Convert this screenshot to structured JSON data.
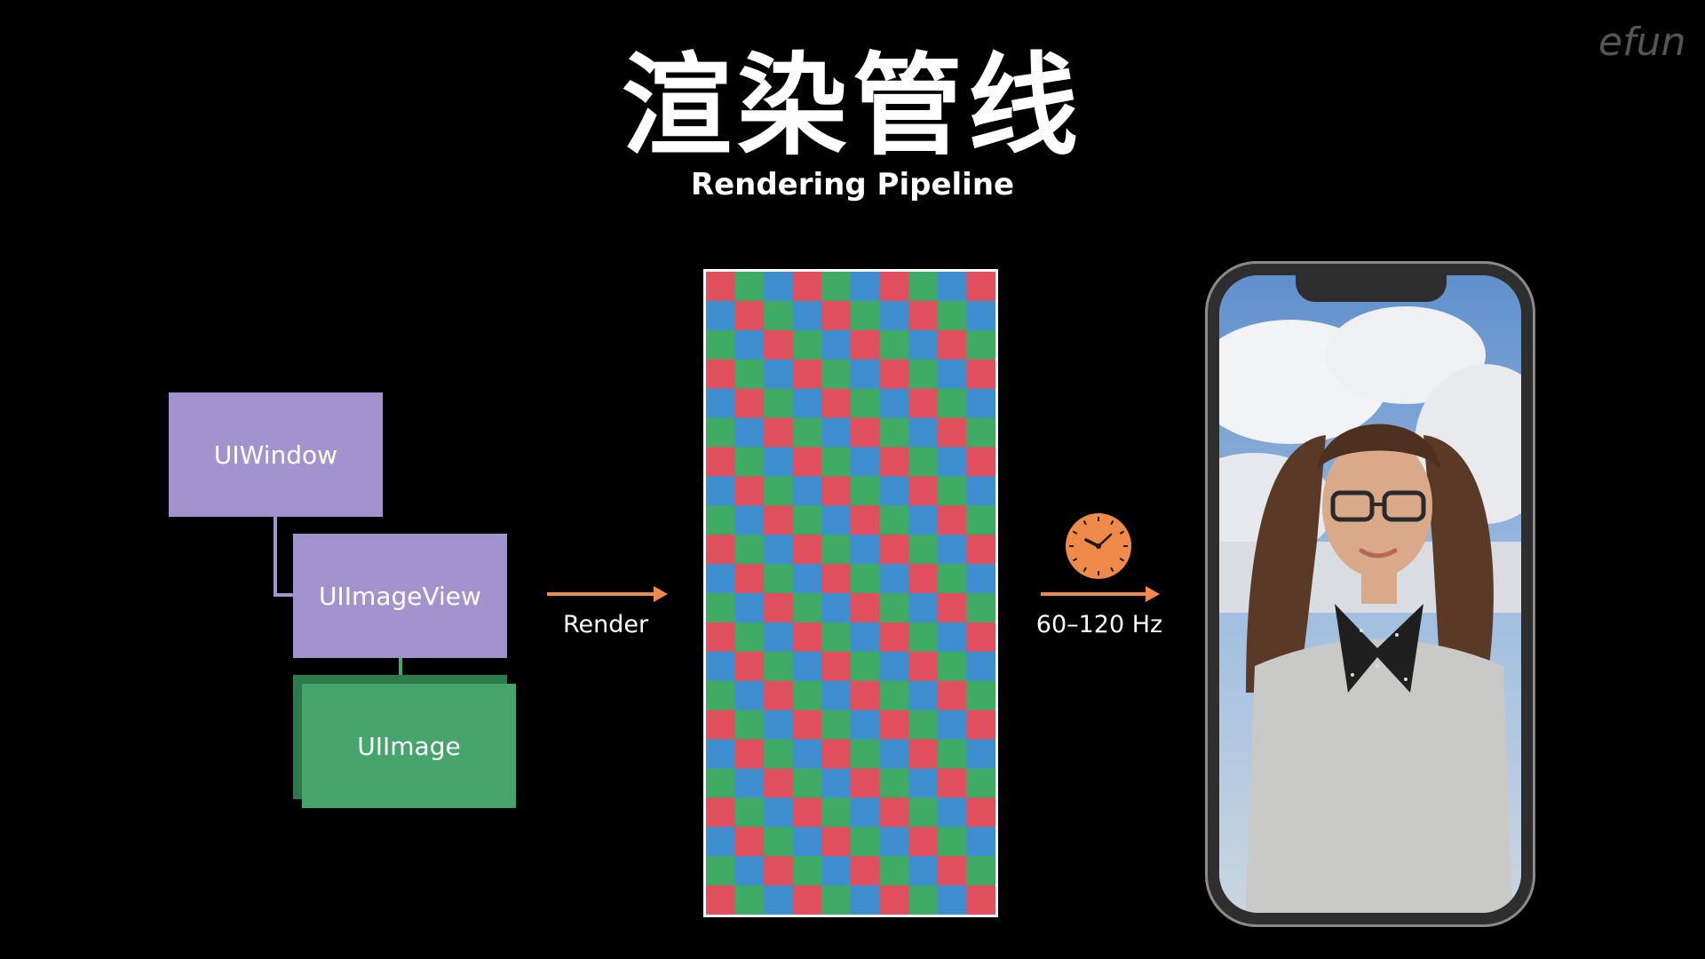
{
  "slide": {
    "title": "渲染管线",
    "subtitle": "Rendering Pipeline",
    "logo_text": "efun"
  },
  "hierarchy": {
    "window_label": "UIWindow",
    "image_view_label": "UIImageView",
    "image_label": "UIImage"
  },
  "render_step": {
    "label": "Render"
  },
  "refresh_step": {
    "label": "60–120 Hz"
  },
  "colors": {
    "accent_orange": "#f08a4b",
    "view_purple": "#a293cf",
    "image_green": "#46a56b",
    "pixel_red": "#e0505e",
    "pixel_green": "#3faa64",
    "pixel_blue": "#3f8fd0"
  },
  "icons": {
    "clock": "clock-icon",
    "phone": "iphone-icon"
  }
}
